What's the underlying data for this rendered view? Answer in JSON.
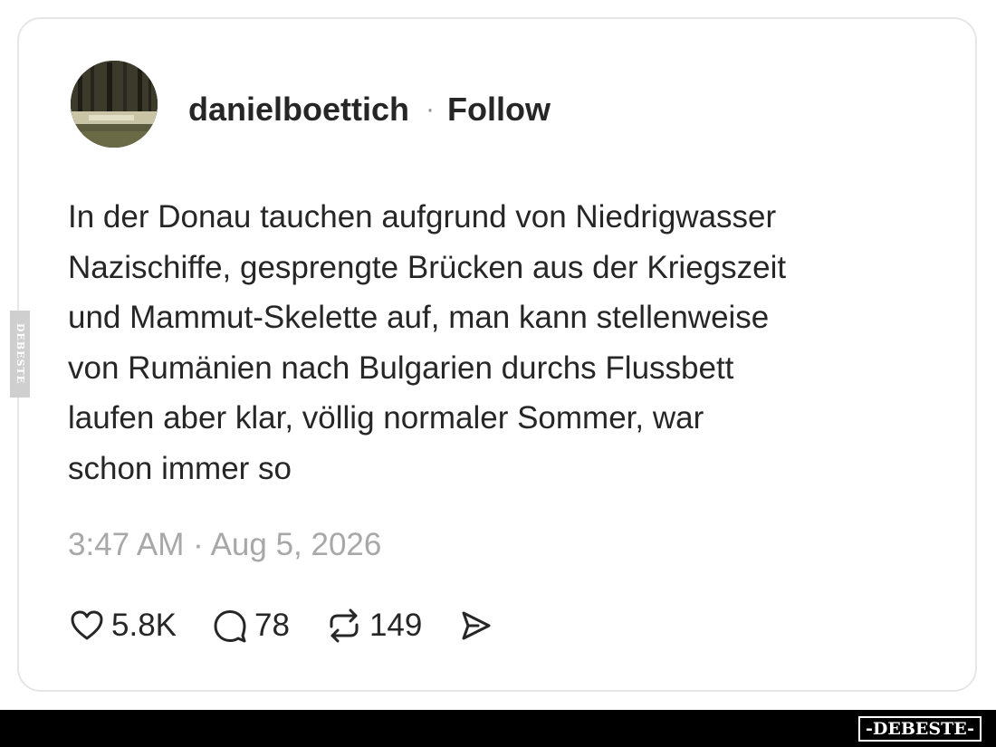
{
  "post": {
    "username": "danielboettich",
    "separator": "·",
    "follow_label": "Follow",
    "text_lines": [
      "In der Donau tauchen aufgrund von Niedrigwasser",
      "Nazischiffe, gesprengte Brücken aus der Kriegszeit",
      "und Mammut-Skelette auf, man kann stellenweise",
      "von Rumänien nach Bulgarien durchs Flussbett",
      "laufen aber klar, völlig normaler Sommer, war",
      "schon immer so"
    ],
    "timestamp": "3:47 AM · Aug 5, 2026"
  },
  "actions": {
    "like": {
      "icon": "heart-icon",
      "count": "5.8K"
    },
    "comment": {
      "icon": "comment-icon",
      "count": "78"
    },
    "repost": {
      "icon": "repost-icon",
      "count": "149"
    },
    "share": {
      "icon": "share-icon"
    }
  },
  "watermark": {
    "side_text": "DEBESTE",
    "brand_text": "-DEBESTE-"
  }
}
